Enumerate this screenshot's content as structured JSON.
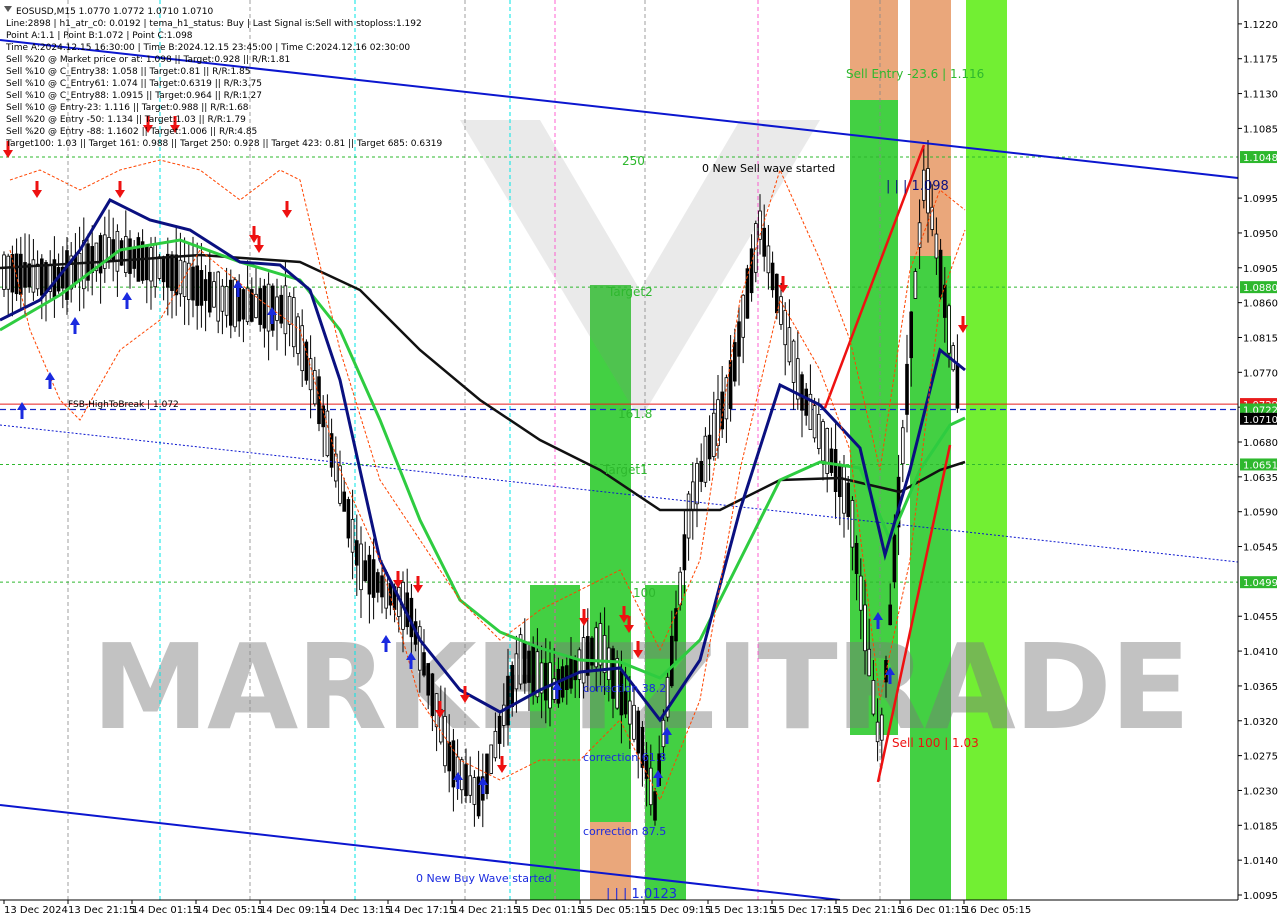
{
  "chart_data": {
    "type": "candlestick",
    "symbol_line": "EOSUSD,M15  1.0770 1.0772 1.0710 1.0710",
    "info_lines": [
      "Line:2898 | h1_atr_c0: 0.0192 | tema_h1_status: Buy | Last Signal is:Sell with stoploss:1.192",
      "Point A:1.1 | Point B:1.072 | Point C:1.098",
      "Time A:2024.12.15 16:30:00 | Time B:2024.12.15 23:45:00 | Time C:2024.12.16 02:30:00",
      "Sell %20 @ Market price or at: 1.098 || Target:0.928 || R/R:1.81",
      "Sell %10 @ C_Entry38: 1.058 || Target:0.81 || R/R:1.85",
      "Sell %10 @ C_Entry61: 1.074 || Target:0.6319 || R/R:3.75",
      "Sell %10 @ C_Entry88: 1.0915 || Target:0.964 || R/R:1.27",
      "Sell %10 @ Entry-23: 1.116 || Target:0.988 || R/R:1.68",
      "Sell %20 @ Entry -50: 1.134 || Target:1.03 || R/R:1.79",
      "Sell %20 @ Entry -88: 1.1602 || Target:1.006 || R/R:4.85",
      "Target100: 1.03 || Target 161: 0.988 || Target 250: 0.928 || Target 423: 0.81 || Target 685: 0.6319"
    ],
    "y_range": [
      1.0095,
      1.1225
    ],
    "y_ticks": [
      "1.1220",
      "1.1175",
      "1.1130",
      "1.1085",
      "1.1048",
      "1.0995",
      "1.0950",
      "1.0905",
      "1.0860",
      "1.0815",
      "1.0770",
      "1.0725",
      "1.0680",
      "1.0635",
      "1.0590",
      "1.0545",
      "1.0499",
      "1.0455",
      "1.0410",
      "1.0365",
      "1.0320",
      "1.0275",
      "1.0230",
      "1.0185",
      "1.0140",
      "1.0095"
    ],
    "x_ticks": [
      "13 Dec 2024",
      "13 Dec 21:15",
      "14 Dec 01:15",
      "14 Dec 05:15",
      "14 Dec 09:15",
      "14 Dec 13:15",
      "14 Dec 17:15",
      "14 Dec 21:15",
      "15 Dec 01:15",
      "15 Dec 05:15",
      "15 Dec 09:15",
      "15 Dec 13:15",
      "15 Dec 17:15",
      "15 Dec 21:15",
      "16 Dec 01:15",
      "16 Dec 05:15"
    ],
    "price_tags": [
      {
        "label": "1.1048",
        "value": 1.1048,
        "color": "#2eb82e"
      },
      {
        "label": "1.0880",
        "value": 1.088,
        "color": "#2eb82e"
      },
      {
        "label": "1.0729",
        "value": 1.0729,
        "color": "#e81c1c"
      },
      {
        "label": "1.0722",
        "value": 1.0722,
        "color": "#2eb82e"
      },
      {
        "label": "1.0710",
        "value": 1.071,
        "color": "#000000"
      },
      {
        "label": "1.0651",
        "value": 1.0651,
        "color": "#2eb82e"
      },
      {
        "label": "1.0499",
        "value": 1.0499,
        "color": "#2eb82e"
      }
    ],
    "annotations": {
      "level_250": "250",
      "target2": "Target2",
      "fib_1618": "161.8",
      "target1": "Target1",
      "level_100": "100",
      "sell_wave": "0 New Sell wave started",
      "buy_wave": "0 New Buy Wave started",
      "sell_entry": "Sell Entry -23.6 | 1.116",
      "point_c": "| | | 1.098",
      "point_b": "| | | 1.0123",
      "sell_100": "Sell 100 | 1.03",
      "corr_382": "correction 38.2",
      "corr_618": "correction 61.8",
      "corr_875": "correction 87.5",
      "fsb": "FSB-HighToBreak | 1.072"
    },
    "watermark": "MARKETZITRADE",
    "colors": {
      "green_zone": "#33cc33",
      "bright_green": "#66ee22",
      "orange_zone": "#e8a070",
      "blue_line": "#0b16cf",
      "ma_green": "#2ecc40",
      "ma_navy": "#0a1080",
      "ma_black": "#111111",
      "red_line": "#ee1111",
      "magenta_line": "#ff3cc8",
      "cyan_line": "#00e5e5"
    },
    "grid": false
  }
}
